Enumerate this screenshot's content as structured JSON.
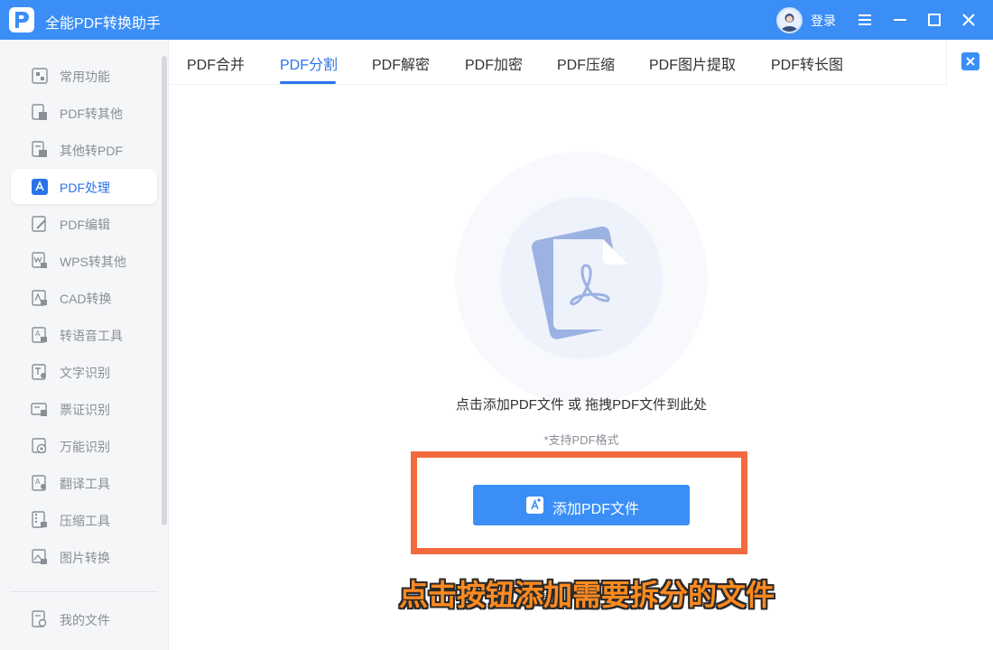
{
  "app": {
    "title": "全能PDF转换助手",
    "login_label": "登录"
  },
  "window_controls": [
    "menu-icon",
    "minimize-icon",
    "maximize-icon",
    "close-icon"
  ],
  "sidebar": {
    "items": [
      {
        "label": "常用功能",
        "icon": "star-grid-icon"
      },
      {
        "label": "PDF转其他",
        "icon": "pdf-convert-icon"
      },
      {
        "label": "其他转PDF",
        "icon": "to-pdf-icon"
      },
      {
        "label": "PDF处理",
        "icon": "pdf-process-icon",
        "active": true
      },
      {
        "label": "PDF编辑",
        "icon": "pdf-edit-icon"
      },
      {
        "label": "WPS转其他",
        "icon": "wps-icon"
      },
      {
        "label": "CAD转换",
        "icon": "cad-icon"
      },
      {
        "label": "转语音工具",
        "icon": "voice-icon"
      },
      {
        "label": "文字识别",
        "icon": "text-ocr-icon"
      },
      {
        "label": "票证识别",
        "icon": "ticket-icon"
      },
      {
        "label": "万能识别",
        "icon": "universal-ocr-icon"
      },
      {
        "label": "翻译工具",
        "icon": "translate-icon"
      },
      {
        "label": "压缩工具",
        "icon": "zip-icon"
      },
      {
        "label": "图片转换",
        "icon": "image-convert-icon"
      }
    ],
    "bottom_item": {
      "label": "我的文件",
      "icon": "my-files-icon"
    }
  },
  "tabs": [
    {
      "label": "PDF合并"
    },
    {
      "label": "PDF分割",
      "active": true
    },
    {
      "label": "PDF解密"
    },
    {
      "label": "PDF加密"
    },
    {
      "label": "PDF压缩"
    },
    {
      "label": "PDF图片提取"
    },
    {
      "label": "PDF转长图"
    }
  ],
  "main": {
    "hint": "点击添加PDF文件 或 拖拽PDF文件到此处",
    "support": "*支持PDF格式",
    "add_button": "添加PDF文件",
    "caption": "点击按钮添加需要拆分的文件"
  },
  "colors": {
    "brand": "#3a8ef6",
    "active_text": "#2b73e9",
    "highlight_border": "#f26a3d",
    "caption": "#ff8a1f"
  }
}
